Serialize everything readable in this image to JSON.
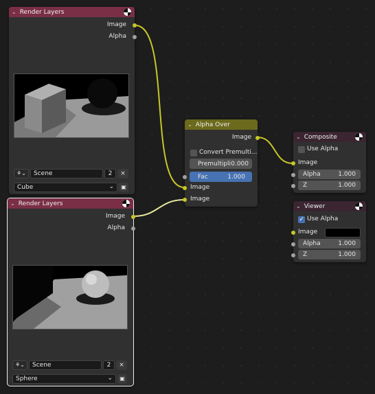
{
  "colors": {
    "render_layers_header": "#7a2f46",
    "alpha_over_header": "#6c6a1c",
    "output_header": "#3a2530",
    "image_socket": "#c7c729",
    "value_socket": "#a1a1a1",
    "slider_active": "#4772b3"
  },
  "render_layers_1": {
    "title": "Render Layers",
    "outputs": {
      "image": "Image",
      "alpha": "Alpha"
    },
    "scene": "Scene",
    "scene_users": "2",
    "layer": "Cube"
  },
  "render_layers_2": {
    "title": "Render Layers",
    "outputs": {
      "image": "Image",
      "alpha": "Alpha"
    },
    "scene": "Scene",
    "scene_users": "2",
    "layer": "Sphere"
  },
  "alpha_over": {
    "title": "Alpha Over",
    "output": "Image",
    "convert_premultiplied": "Convert Premulti...",
    "premultiplied": {
      "label": "Premultipli",
      "value": "0.000"
    },
    "fac": {
      "label": "Fac",
      "value": "1.000"
    },
    "inputs": {
      "image1": "Image",
      "image2": "Image"
    }
  },
  "composite": {
    "title": "Composite",
    "use_alpha": "Use Alpha",
    "use_alpha_checked": false,
    "image": "Image",
    "alpha": {
      "label": "Alpha",
      "value": "1.000"
    },
    "z": {
      "label": "Z",
      "value": "1.000"
    }
  },
  "viewer": {
    "title": "Viewer",
    "use_alpha": "Use Alpha",
    "use_alpha_checked": true,
    "image": "Image",
    "image_color": "#000000",
    "alpha": {
      "label": "Alpha",
      "value": "1.000"
    },
    "z": {
      "label": "Z",
      "value": "1.000"
    }
  },
  "icons": {
    "node_header": "composite-node-icon",
    "scene": "scene-icon",
    "close": "close-icon",
    "dropdown": "chevron-down-icon",
    "layer_browse": "render-layer-icon",
    "collapse": "chevron-down-icon",
    "checkbox_mark": "✓"
  }
}
